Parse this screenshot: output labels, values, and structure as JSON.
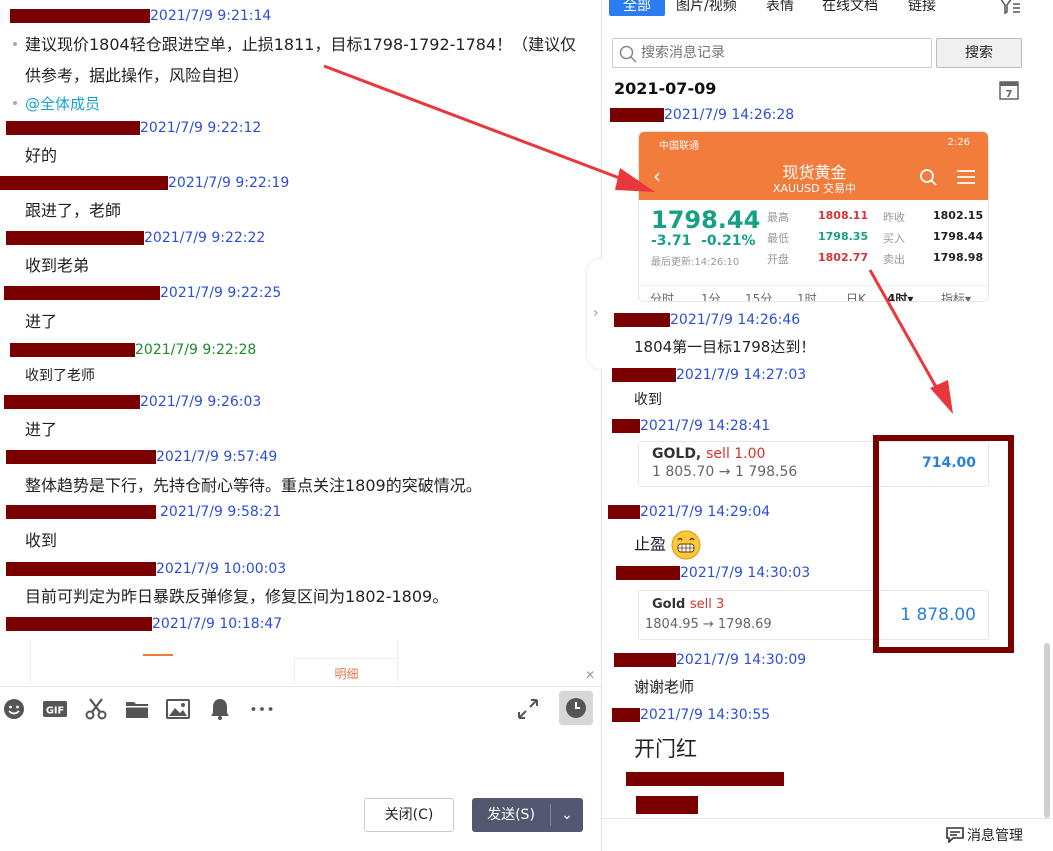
{
  "chat": {
    "messages": [
      {
        "time": "2021/7/9 9:21:14",
        "lines": [
          "建议现价1804轻仓跟进空单，止损1811，目标1798-1792-1784！（建议仅供参考，据此操作，风险自担）"
        ],
        "mention": "@全体成员"
      },
      {
        "time": "2021/7/9 9:22:12",
        "text": "好的"
      },
      {
        "time": "2021/7/9 9:22:19",
        "text": "跟进了，老師"
      },
      {
        "time": "2021/7/9 9:22:22",
        "text": "收到老弟"
      },
      {
        "time": "2021/7/9 9:22:25",
        "text": "进了"
      },
      {
        "time": "2021/7/9 9:22:28",
        "text": "收到了老师"
      },
      {
        "time": "2021/7/9 9:26:03",
        "text": "进了"
      },
      {
        "time": "2021/7/9 9:57:49",
        "text": "整体趋势是下行，先持仓耐心等待。重点关注1809的突破情况。"
      },
      {
        "time": "2021/7/9 9:58:21",
        "text": "收到"
      },
      {
        "time": "2021/7/9 10:00:03",
        "text": "目前可判定为昨日暴跌反弹修复，修复区间为1802-1809。"
      },
      {
        "time": "2021/7/9 10:18:47",
        "text": ""
      }
    ],
    "mini_tab_label": "明细"
  },
  "toolbar": {
    "icons": [
      "emoji-icon",
      "gif-icon",
      "scissors-icon",
      "folder-icon",
      "image-icon",
      "bell-icon",
      "more-icon",
      "expand-icon",
      "history-icon"
    ],
    "gif_label": "GIF",
    "close_label": "关闭(C)",
    "send_label": "发送(S)"
  },
  "history": {
    "tabs": [
      "全部",
      "图片/视频",
      "表情",
      "在线文档",
      "链接"
    ],
    "search_placeholder": "搜索消息记录",
    "search_button": "搜索",
    "date": "2021-07-09",
    "calendar_day": "7",
    "messages": [
      {
        "time": "2021/7/9 14:26:28"
      },
      {
        "time": "2021/7/9 14:26:46",
        "text": "1804第一目标1798达到！"
      },
      {
        "time": "2021/7/9 14:27:03",
        "text": "收到"
      },
      {
        "time": "2021/7/9 14:28:41"
      },
      {
        "time": "2021/7/9 14:29:04",
        "text": "止盈"
      },
      {
        "time": "2021/7/9 14:30:03"
      },
      {
        "time": "2021/7/9 14:30:09",
        "text": "谢谢老师"
      },
      {
        "time": "2021/7/9 14:30:55",
        "text": "开门红"
      }
    ],
    "footer": "消息管理"
  },
  "gold_card": {
    "status_left": "中国联通",
    "status_time": "2:26",
    "title": "现货黄金",
    "subtitle": "XAUUSD 交易中",
    "price": "1798.44",
    "change": "-3.71",
    "change_pct": "-0.21%",
    "updated": "最后更新:14:26:10",
    "quotes": [
      {
        "label": "最高",
        "value": "1808.11",
        "label2": "昨收",
        "value2": "1802.15"
      },
      {
        "label": "最低",
        "value": "1798.35",
        "label2": "买入",
        "value2": "1798.44"
      },
      {
        "label": "开盘",
        "value": "1802.77",
        "label2": "卖出",
        "value2": "1798.98"
      }
    ],
    "periods": [
      "分时",
      "1分",
      "15分",
      "1时",
      "日K",
      "4时▾",
      "指标▾"
    ]
  },
  "trade1": {
    "symbol": "GOLD,",
    "side": "sell 1.00",
    "prices": "1 805.70 → 1 798.56",
    "amount": "714.00"
  },
  "trade2": {
    "symbol": "Gold",
    "side": "sell 3",
    "prices": "1804.95 → 1798.69",
    "amount": "1 878.00"
  },
  "colors": {
    "accent": "#2d7bf0",
    "timestamp": "#2b4fd8",
    "redaction": "#7a0000",
    "arrow": "#e8383d",
    "gold_header": "#f27c3b"
  }
}
